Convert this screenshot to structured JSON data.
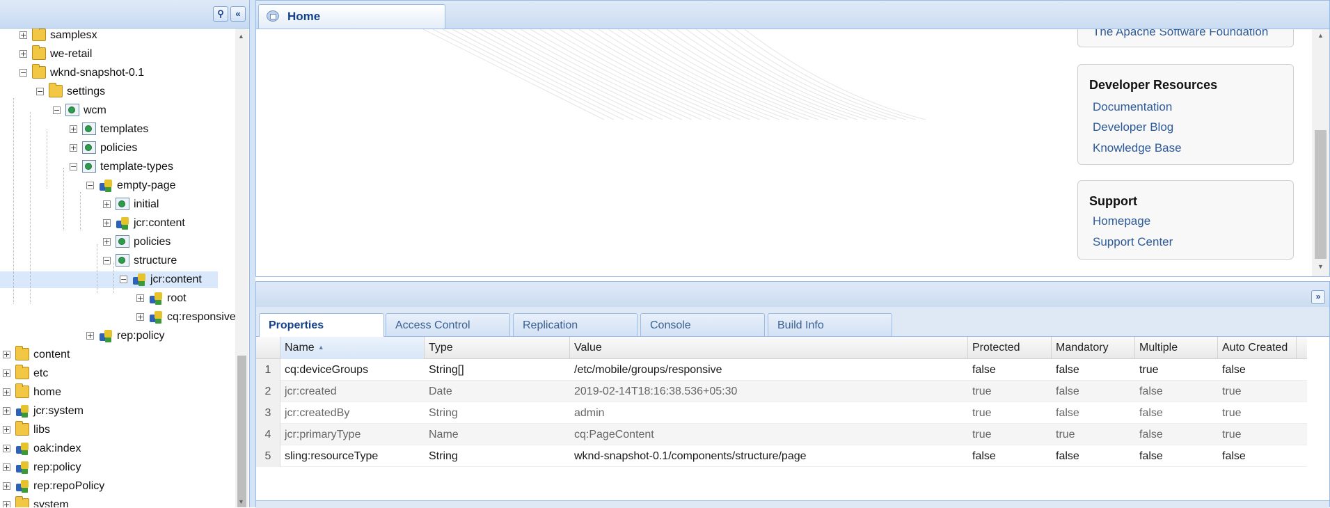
{
  "left_panel": {
    "buttons": [
      {
        "name": "tree-options-button",
        "icon": "binoculars-icon",
        "glyph": "⚲"
      },
      {
        "name": "collapse-left-button",
        "icon": "double-chevron-left-icon",
        "glyph": "«"
      }
    ],
    "tree": [
      {
        "label": "samplesx",
        "icon": "folder",
        "toggle": "+",
        "level": 1
      },
      {
        "label": "we-retail",
        "icon": "folder",
        "toggle": "+",
        "level": 1
      },
      {
        "label": "wknd-snapshot-0.1",
        "icon": "folder",
        "toggle": "−",
        "level": 1
      },
      {
        "label": "settings",
        "icon": "folder",
        "toggle": "−",
        "level": 2
      },
      {
        "label": "wcm",
        "icon": "page",
        "toggle": "−",
        "level": 3
      },
      {
        "label": "templates",
        "icon": "page",
        "toggle": "+",
        "level": 4
      },
      {
        "label": "policies",
        "icon": "page",
        "toggle": "+",
        "level": 4
      },
      {
        "label": "template-types",
        "icon": "page",
        "toggle": "−",
        "level": 4
      },
      {
        "label": "empty-page",
        "icon": "node",
        "toggle": "−",
        "level": 5
      },
      {
        "label": "initial",
        "icon": "page",
        "toggle": "+",
        "level": 6
      },
      {
        "label": "jcr:content",
        "icon": "node",
        "toggle": "+",
        "level": 6
      },
      {
        "label": "policies",
        "icon": "page",
        "toggle": "+",
        "level": 6
      },
      {
        "label": "structure",
        "icon": "page",
        "toggle": "−",
        "level": 6
      },
      {
        "label": "jcr:content",
        "icon": "node",
        "toggle": "−",
        "level": 7,
        "selected": true
      },
      {
        "label": "root",
        "icon": "node",
        "toggle": "+",
        "level": 8
      },
      {
        "label": "cq:responsive",
        "icon": "node",
        "toggle": "+",
        "level": 8
      },
      {
        "label": "rep:policy",
        "icon": "node",
        "toggle": "+",
        "level": 5
      },
      {
        "label": "content",
        "icon": "folder",
        "toggle": "+",
        "level": 0
      },
      {
        "label": "etc",
        "icon": "folder",
        "toggle": "+",
        "level": 0
      },
      {
        "label": "home",
        "icon": "folder",
        "toggle": "+",
        "level": 0
      },
      {
        "label": "jcr:system",
        "icon": "node",
        "toggle": "+",
        "level": 0
      },
      {
        "label": "libs",
        "icon": "folder",
        "toggle": "+",
        "level": 0
      },
      {
        "label": "oak:index",
        "icon": "node",
        "toggle": "+",
        "level": 0
      },
      {
        "label": "rep:policy",
        "icon": "node",
        "toggle": "+",
        "level": 0
      },
      {
        "label": "rep:repoPolicy",
        "icon": "node",
        "toggle": "+",
        "level": 0
      },
      {
        "label": "system",
        "icon": "folder",
        "toggle": "+",
        "level": 0
      }
    ]
  },
  "top_panel": {
    "tab_label": "Home",
    "tab_icon": "home-icon",
    "partial_link": "The Apache Software Foundation",
    "cards": [
      {
        "title": "Developer Resources",
        "links": [
          "Documentation",
          "Developer Blog",
          "Knowledge Base"
        ]
      },
      {
        "title": "Support",
        "links": [
          "Homepage",
          "Support Center"
        ]
      }
    ]
  },
  "bottom_panel": {
    "tabs": [
      "Properties",
      "Access Control",
      "Replication",
      "Console",
      "Build Info"
    ],
    "active_tab": "Properties",
    "columns": [
      "Name",
      "Type",
      "Value",
      "Protected",
      "Mandatory",
      "Multiple",
      "Auto Created"
    ],
    "sorted_column": "Name",
    "sort_direction": "ascending",
    "rows": [
      {
        "num": "1",
        "name": "cq:deviceGroups",
        "type": "String[]",
        "value": "/etc/mobile/groups/responsive",
        "protected": "false",
        "mandatory": "false",
        "multiple": "true",
        "auto": "false"
      },
      {
        "num": "2",
        "name": "jcr:created",
        "type": "Date",
        "value": "2019-02-14T18:16:38.536+05:30",
        "protected": "true",
        "mandatory": "false",
        "multiple": "false",
        "auto": "true"
      },
      {
        "num": "3",
        "name": "jcr:createdBy",
        "type": "String",
        "value": "admin",
        "protected": "true",
        "mandatory": "false",
        "multiple": "false",
        "auto": "true"
      },
      {
        "num": "4",
        "name": "jcr:primaryType",
        "type": "Name",
        "value": "cq:PageContent",
        "protected": "true",
        "mandatory": "true",
        "multiple": "false",
        "auto": "true"
      },
      {
        "num": "5",
        "name": "sling:resourceType",
        "type": "String",
        "value": "wknd-snapshot-0.1/components/structure/page",
        "protected": "false",
        "mandatory": "false",
        "multiple": "false",
        "auto": "false"
      }
    ]
  },
  "colors": {
    "header_blue": "#15428b",
    "selection": "#d9e8fb",
    "link": "#2c5a9a",
    "border": "#99bbe8"
  }
}
